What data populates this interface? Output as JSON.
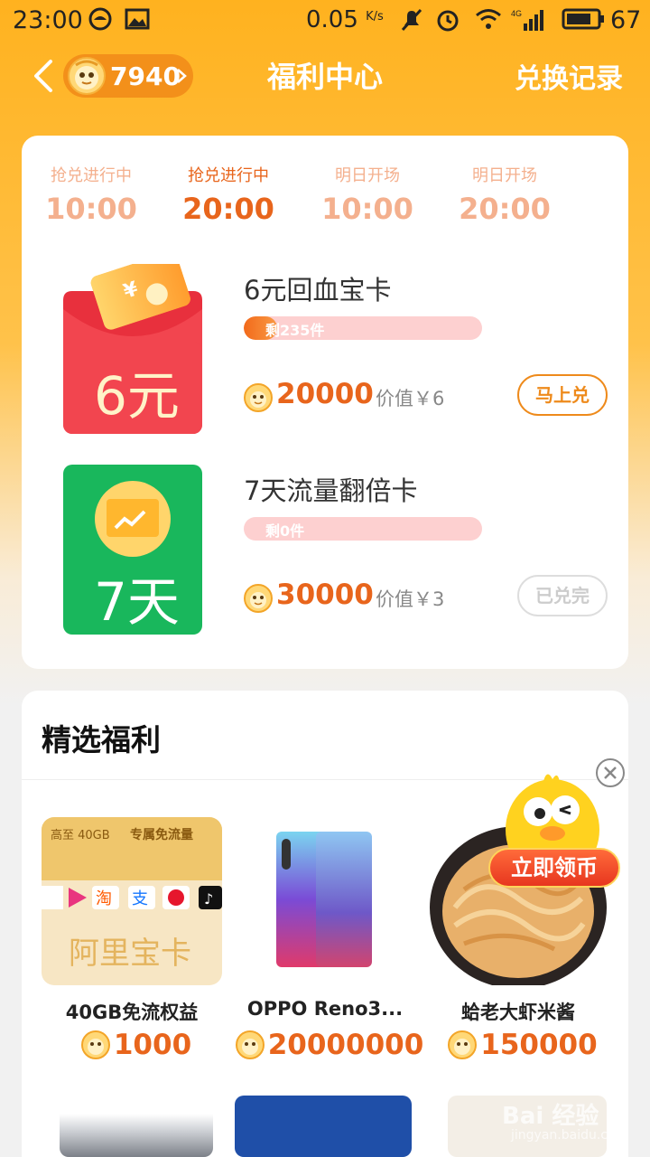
{
  "status_bar": {
    "time": "23:00",
    "speed": "0.05",
    "speed_unit": "K/s",
    "battery": "67"
  },
  "header": {
    "coins": "7940",
    "title": "福利中心",
    "history": "兑换记录"
  },
  "flash_sale": {
    "slots": [
      {
        "label": "抢兑进行中",
        "time": "10:00",
        "active": false
      },
      {
        "label": "抢兑进行中",
        "time": "20:00",
        "active": true
      },
      {
        "label": "明日开场",
        "time": "10:00",
        "active": false
      },
      {
        "label": "明日开场",
        "time": "20:00",
        "active": false
      }
    ],
    "products": [
      {
        "image_text": "6元",
        "name": "6元回血宝卡",
        "stock": "剩235件",
        "stock_level": 0.14,
        "price": "20000",
        "value": "价值￥6",
        "button": "马上兑"
      },
      {
        "image_text": "7天",
        "name": "7天流量翻倍卡",
        "stock": "剩0件",
        "stock_level": 0,
        "price": "30000",
        "value": "价值￥3",
        "button": "已兑完"
      }
    ]
  },
  "selected": {
    "title": "精选福利",
    "items": [
      {
        "name": "40GB免流权益",
        "price": "1000",
        "img_top": "高至 40GB",
        "img_top2": "专属免流量",
        "img_brand": "阿里宝卡"
      },
      {
        "name": "OPPO Reno3...",
        "price": "20000000"
      },
      {
        "name": "蛤老大虾米酱",
        "price": "150000"
      }
    ],
    "float_button": "立即领币"
  },
  "watermark": {
    "text": "Bai 经验",
    "sub": "jingyan.baidu.com"
  },
  "colors": {
    "header_bg": "#ffb21f",
    "accent": "#e8651c",
    "coin_pill": "#f3901a"
  }
}
